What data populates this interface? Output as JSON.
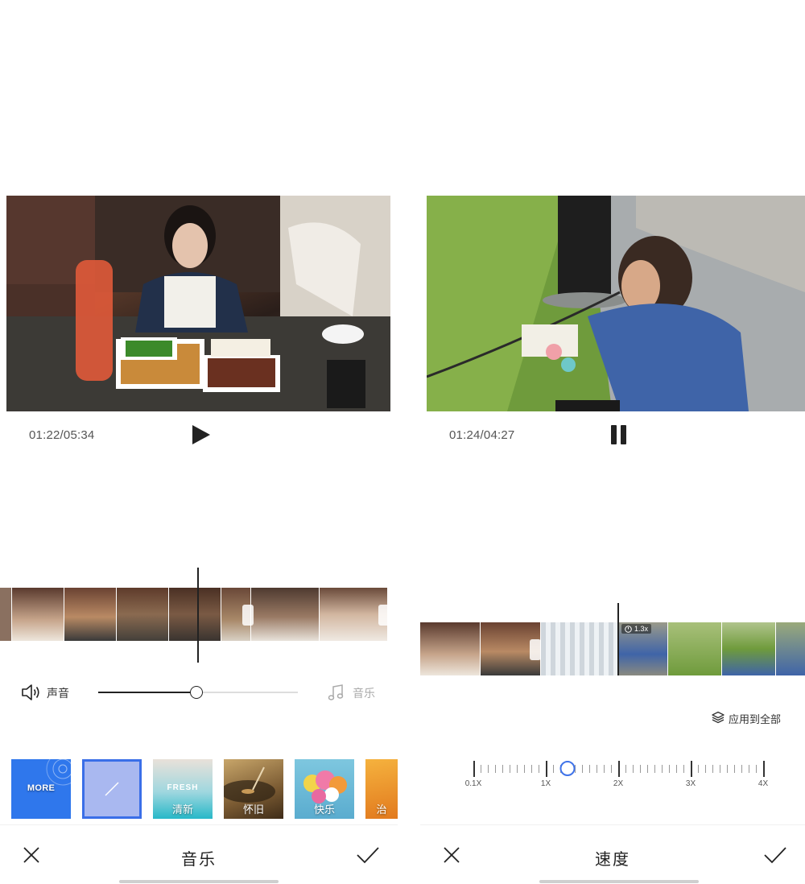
{
  "screens": [
    {
      "id": "music",
      "time_display": "01:22/05:34",
      "play_state": "paused",
      "volume": {
        "label": "声音",
        "level": 0.49
      },
      "music": {
        "label": "音乐"
      },
      "presets": [
        {
          "id": "more",
          "label": "MORE",
          "selected": false
        },
        {
          "id": "none",
          "label": "",
          "selected": true
        },
        {
          "id": "fresh",
          "tag": "FRESH",
          "label": "清新",
          "selected": false
        },
        {
          "id": "nostalgia",
          "label": "怀旧",
          "selected": false
        },
        {
          "id": "happy",
          "label": "快乐",
          "selected": false
        },
        {
          "id": "heal",
          "label": "治",
          "selected": false
        }
      ],
      "bottom_bar": {
        "title": "音乐"
      }
    },
    {
      "id": "speed",
      "time_display": "01:24/04:27",
      "play_state": "playing",
      "clip_speed_badge": "1.3x",
      "apply_all_label": "应用到全部",
      "speed": {
        "value": 1.3,
        "labels": [
          "0.1X",
          "1X",
          "2X",
          "3X",
          "4X"
        ]
      },
      "bottom_bar": {
        "title": "速度"
      }
    }
  ],
  "colors": {
    "accent": "#3f73e9",
    "more_tile": "#2f77ec",
    "selected_border": "#3a6ee8",
    "text_primary": "#222222",
    "text_muted": "#aaaaaa"
  },
  "icons": {
    "play": "play-icon",
    "pause": "pause-icon",
    "sound": "speaker-icon",
    "music": "music-note-icon",
    "apply_all": "layers-icon",
    "close": "close-icon",
    "confirm": "check-icon"
  }
}
